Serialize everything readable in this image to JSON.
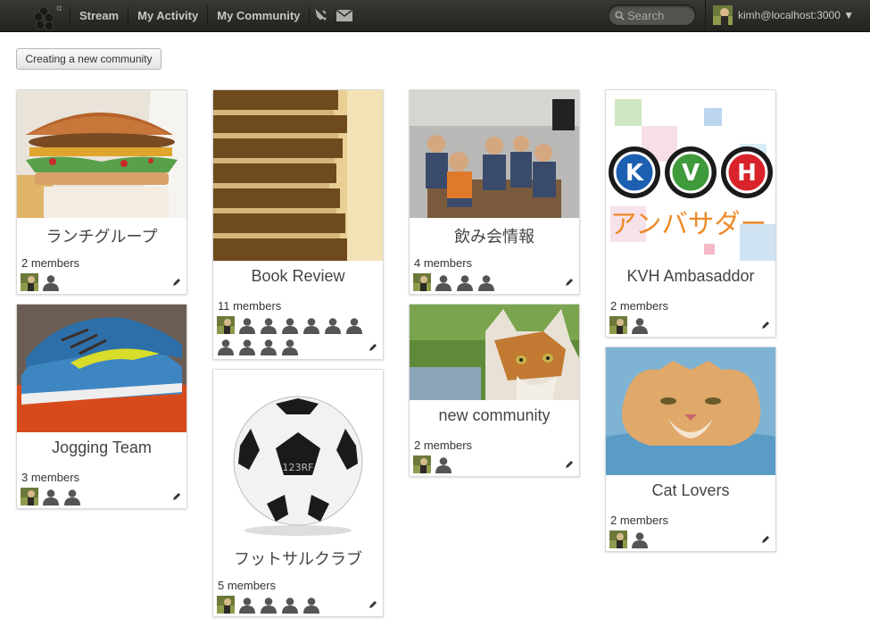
{
  "header": {
    "logo_sup": "α",
    "nav": [
      "Stream",
      "My Activity",
      "My Community"
    ],
    "search_placeholder": "Search",
    "user": "kimh@localhost:3000 ▼"
  },
  "create_button": "Creating a new community",
  "communities": [
    {
      "name": "ランチグループ",
      "members": "2 members",
      "avatars": [
        "photo",
        "person"
      ]
    },
    {
      "name": "Jogging Team",
      "members": "3 members",
      "avatars": [
        "photo",
        "person",
        "person"
      ]
    },
    {
      "name": "Book Review",
      "members": "11 members",
      "avatars": [
        "photo",
        "person",
        "person",
        "person",
        "person",
        "person",
        "person",
        "person",
        "person",
        "person",
        "person"
      ]
    },
    {
      "name": "フットサルクラブ",
      "members": "5 members",
      "avatars": [
        "photo",
        "person",
        "person",
        "person",
        "person"
      ]
    },
    {
      "name": "飲み会情報",
      "members": "4 members",
      "avatars": [
        "photo",
        "person",
        "person",
        "person"
      ]
    },
    {
      "name": "new community",
      "members": "2 members",
      "avatars": [
        "photo",
        "person"
      ]
    },
    {
      "name": "KVH Ambasaddor",
      "members": "2 members",
      "avatars": [
        "photo",
        "person"
      ]
    },
    {
      "name": "Cat Lovers",
      "members": "2 members",
      "avatars": [
        "photo",
        "person"
      ]
    }
  ],
  "kvh_logo": {
    "letters": [
      "K",
      "V",
      "H"
    ],
    "tagline": "アンバサダー"
  },
  "ball_watermark": "123RF",
  "colors": {
    "topbar": "#2e2c29",
    "accent_green": "#3e9a3a",
    "kvh_red": "#d9232a",
    "kvh_blue": "#1d5fb0"
  }
}
